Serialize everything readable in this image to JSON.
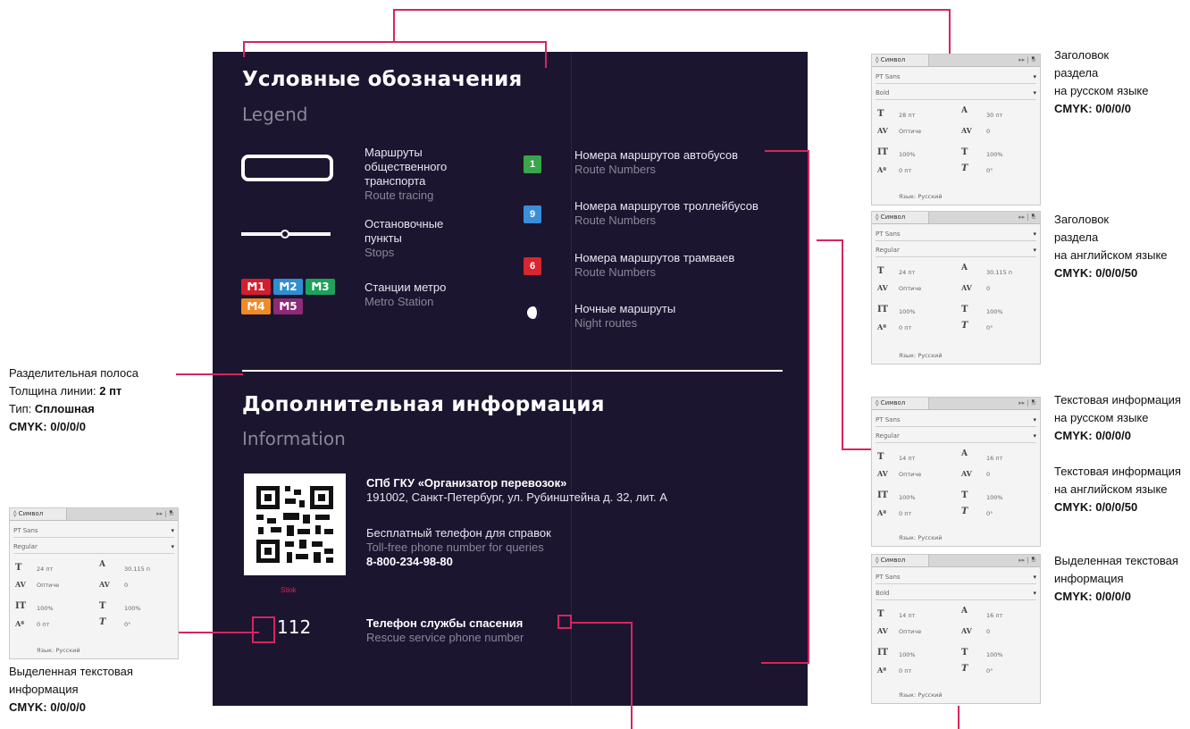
{
  "legend": {
    "title_ru": "Условные обозначения",
    "title_en": "Legend",
    "items_left": [
      {
        "ru": [
          "Маршруты",
          "общественного",
          "транспорта"
        ],
        "en": "Route tracing"
      },
      {
        "ru": [
          "Остановочные",
          "пункты"
        ],
        "en": "Stops"
      },
      {
        "ru": [
          "Станции метро"
        ],
        "en": "Metro Station"
      }
    ],
    "metro_lines": [
      {
        "label": "1",
        "color": "#d11f2e"
      },
      {
        "label": "2",
        "color": "#2f8fd0"
      },
      {
        "label": "3",
        "color": "#1fa25a"
      },
      {
        "label": "4",
        "color": "#f08a24"
      },
      {
        "label": "5",
        "color": "#8e2a78"
      }
    ],
    "items_right": [
      {
        "badge": "1",
        "badge_color": "#3aa54a",
        "ru": "Номера маршрутов автобусов",
        "en": "Route Numbers"
      },
      {
        "badge": "9",
        "badge_color": "#3b8ed8",
        "ru": "Номера маршрутов троллейбусов",
        "en": "Route Numbers"
      },
      {
        "badge": "6",
        "badge_color": "#d7262e",
        "ru": "Номера маршрутов трамваев",
        "en": "Route Numbers"
      },
      {
        "icon": "night-icon",
        "ru": "Ночные маршруты",
        "en": "Night routes"
      }
    ]
  },
  "info": {
    "title_ru": "Дополнительная информация",
    "title_en": "Information",
    "org_name": "СПб ГКУ «Организатор перевозок»",
    "org_address": "191002, Санкт-Петербург, ул. Рубинштейна д. 32, лит. А",
    "phone_label_ru": "Бесплатный телефон для справок",
    "phone_label_en": "Toll-free phone number for queries",
    "phone_number": "8-800-234-98-80",
    "qr_caption": "Stiok",
    "rescue_number": "112",
    "rescue_label_ru": "Телефон службы спасения",
    "rescue_label_en": "Rescue service phone number"
  },
  "annotations": {
    "heading_ru": {
      "lines": [
        "Заголовок",
        "раздела",
        "на русском языке"
      ],
      "cmyk": "CMYK: 0/0/0/0"
    },
    "heading_en": {
      "lines": [
        "Заголовок",
        "раздела",
        "на английском языке"
      ],
      "cmyk": "CMYK: 0/0/0/50"
    },
    "text_ru": {
      "lines": [
        "Текстовая информация",
        "на русском языке"
      ],
      "cmyk": "CMYK: 0/0/0/0"
    },
    "text_en": {
      "lines": [
        "Текстовая информация",
        "на английском языке"
      ],
      "cmyk": "CMYK: 0/0/0/50"
    },
    "highlight_right": {
      "lines": [
        "Выделенная текстовая",
        "информация"
      ],
      "cmyk": "CMYK: 0/0/0/0"
    },
    "divider": {
      "title": "Разделительная полоса",
      "thickness_label": "Толщина линии:",
      "thickness": "2 пт",
      "type_label": "Тип:",
      "type": "Сплошная",
      "cmyk": "CMYK: 0/0/0/0"
    },
    "highlight_left": {
      "lines": [
        "Выделенная текстовая",
        "информация"
      ],
      "cmyk": "CMYK: 0/0/0/0"
    }
  },
  "panels": [
    {
      "tab": "◊ Символ",
      "font": "PT Sans",
      "style": "Bold",
      "size": "28 пт",
      "leading": "30 пт",
      "kern": "Оптиче",
      "track": "0",
      "vscale": "100%",
      "hscale": "100%",
      "baseline": "0 пт",
      "skew": "0°",
      "lang_label": "Язык:",
      "lang": "Русский"
    },
    {
      "tab": "◊ Символ",
      "font": "PT Sans",
      "style": "Regular",
      "size": "24 пт",
      "leading": "30.115 п",
      "kern": "Оптиче",
      "track": "0",
      "vscale": "100%",
      "hscale": "100%",
      "baseline": "0 пт",
      "skew": "0°",
      "lang_label": "Язык:",
      "lang": "Русский"
    },
    {
      "tab": "◊ Символ",
      "font": "PT Sans",
      "style": "Regular",
      "size": "14 пт",
      "leading": "16 пт",
      "kern": "Оптиче",
      "track": "0",
      "vscale": "100%",
      "hscale": "100%",
      "baseline": "0 пт",
      "skew": "0°",
      "lang_label": "Язык:",
      "lang": "Русский"
    },
    {
      "tab": "◊ Символ",
      "font": "PT Sans",
      "style": "Bold",
      "size": "14 пт",
      "leading": "16 пт",
      "kern": "Оптиче",
      "track": "0",
      "vscale": "100%",
      "hscale": "100%",
      "baseline": "0 пт",
      "skew": "0°",
      "lang_label": "Язык:",
      "lang": "Русский"
    },
    {
      "tab": "◊ Символ",
      "font": "PT Sans",
      "style": "Regular",
      "size": "24 пт",
      "leading": "30.115 п",
      "kern": "Оптиче",
      "track": "0",
      "vscale": "100%",
      "hscale": "100%",
      "baseline": "0 пт",
      "skew": "0°",
      "lang_label": "Язык:",
      "lang": "Русский"
    }
  ]
}
